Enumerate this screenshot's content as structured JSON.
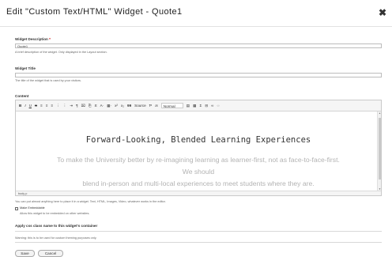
{
  "dialog": {
    "title": "Edit \"Custom Text/HTML\" Widget - Quote1",
    "close_glyph": "✖"
  },
  "form": {
    "description": {
      "label": "Widget Description",
      "required_marker": "*",
      "value": "Quote1",
      "help": "A brief description of the widget. Only displayed in the Layout section."
    },
    "title": {
      "label": "Widget Title",
      "value": "",
      "help": "The title of the widget that is used by your visitors."
    },
    "content": {
      "label": "Content",
      "toolbar": {
        "bold": "B",
        "italic": "I",
        "underline": "U",
        "strike": "S",
        "align_left": "≡",
        "align_center": "≡",
        "align_right": "≡",
        "ordered_list": "⋮",
        "bullet_list": "⋮",
        "indent": "⇥",
        "outdent": "¶",
        "remove_format": "⌧",
        "paste_text": "⎘",
        "spell": "Ƨ",
        "text_color": "A·",
        "bg_color": "▦·",
        "superscript": "x²",
        "subscript": "x₂",
        "blockquote": "99",
        "source_label": "Source",
        "show_blocks": "Ƥ",
        "clear_format": "Ix",
        "format_select": "Normal",
        "image": "▤",
        "table": "▦",
        "symbol": "Σ",
        "hr": "⊟",
        "link": "∞",
        "unlink": "∞"
      },
      "heading": "Forward-Looking, Blended Learning Experiences",
      "paragraph_lines": [
        "To make the University better by re-imagining learning as learner-first, not as face-to-face-first.",
        "We should",
        "blend in-person and multi-local experiences to meet students where they are."
      ],
      "statusbar_path": "body  p",
      "help": "You can put almost anything here to place it in a widget. Text, HTML, Images, Video, whatever works in the editor."
    },
    "embeddable": {
      "label": "Make Embeddable",
      "checked": false,
      "help": "Allow this widget to be embedded on other websites."
    },
    "css_class": {
      "label": "Apply css class name to this widget's container",
      "value": "",
      "help": "Warning: this is to be used for custom theming purposes only."
    }
  },
  "buttons": {
    "save": "Save",
    "cancel": "Cancel"
  }
}
